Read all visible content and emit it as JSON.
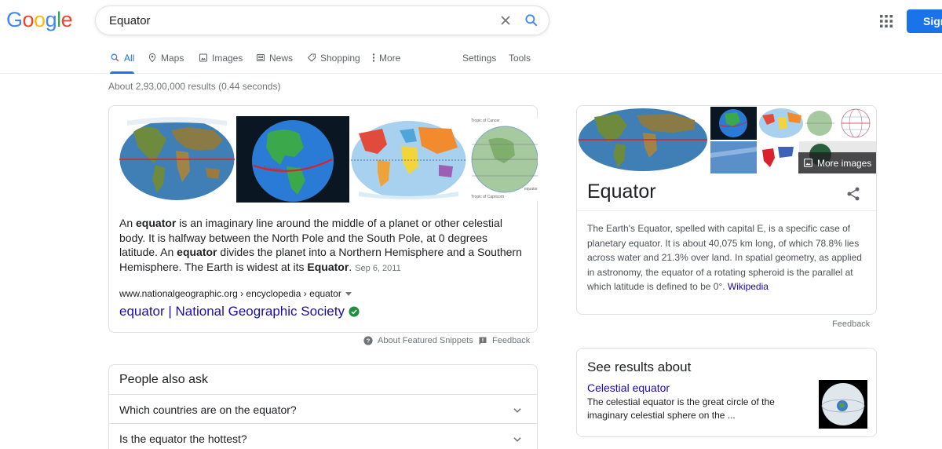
{
  "header": {
    "logo": {
      "letters": [
        "G",
        "o",
        "o",
        "g",
        "l",
        "e"
      ],
      "colors": [
        "#4285f4",
        "#ea4335",
        "#fbbc05",
        "#4285f4",
        "#34a853",
        "#ea4335"
      ]
    },
    "query": "Equator",
    "signin_label": "Sign"
  },
  "tabs": [
    {
      "label": "All",
      "icon": "search-icon",
      "active": true
    },
    {
      "label": "Maps",
      "icon": "map-pin-icon"
    },
    {
      "label": "Images",
      "icon": "image-icon"
    },
    {
      "label": "News",
      "icon": "news-icon"
    },
    {
      "label": "Shopping",
      "icon": "tag-icon"
    },
    {
      "label": "More",
      "icon": "more-vertical-icon"
    }
  ],
  "tools": {
    "settings": "Settings",
    "tools": "Tools"
  },
  "stats": "About 2,93,00,000 results (0.44 seconds)",
  "snippet": {
    "text_parts": {
      "p1": "An ",
      "b1": "equator",
      "p2": " is an imaginary line around the middle of a planet or other celestial body. It is halfway between the North Pole and the South Pole, at 0 degrees latitude. An ",
      "b2": "equator",
      "p3": " divides the planet into a Northern Hemisphere and a Southern Hemisphere. The Earth is widest at its ",
      "b3": "Equator",
      "p4": "."
    },
    "date": "Sep 6, 2011",
    "cite": "www.nationalgeographic.org › encyclopedia › equator",
    "link": "equator | National Geographic Society",
    "globe_label": "Equator",
    "map_label_1": "Tropic of Cancer",
    "map_label_2": "Tropic of Capricorn",
    "map_label_3": "equator"
  },
  "snippet_footer": {
    "about": "About Featured Snippets",
    "feedback": "Feedback"
  },
  "paa": {
    "title": "People also ask",
    "questions": [
      "Which countries are on the equator?",
      "Is the equator the hottest?"
    ]
  },
  "knowledge_panel": {
    "title": "Equator",
    "more_images": "More images",
    "description": "The Earth's Equator, spelled with capital E, is a specific case of planetary equator. It is about 40,075 km long, of which 78.8% lies across water and 21.3% over land. In spatial geometry, as applied in astronomy, the equator of a rotating spheroid is the parallel at which latitude is defined to be 0°.",
    "source": "Wikipedia",
    "feedback": "Feedback"
  },
  "see_results": {
    "title": "See results about",
    "link": "Celestial equator",
    "description": "The celestial equator is the great circle of the imaginary celestial sphere on the ..."
  },
  "colors": {
    "accent": "#1a73e8",
    "link": "#1a0dab",
    "verified": "#1e8e3e"
  }
}
